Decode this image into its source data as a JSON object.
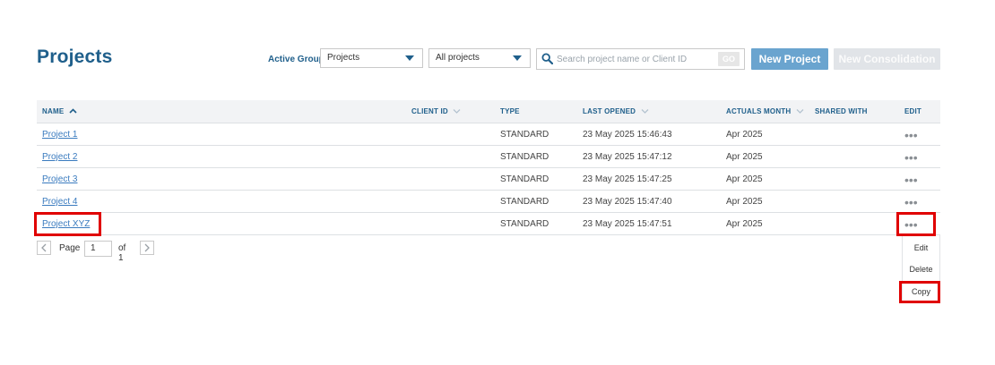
{
  "header": {
    "title": "Projects",
    "active_group_label": "Active Group",
    "group_select_value": "Projects",
    "filter_select_value": "All projects",
    "search_placeholder": "Search project name or Client ID",
    "search_value": "",
    "go_label": "GO",
    "new_project_label": "New Project",
    "new_consolidation_label": "New Consolidation"
  },
  "table": {
    "columns": {
      "name": "NAME",
      "client_id": "CLIENT ID",
      "type": "TYPE",
      "last_opened": "LAST OPENED",
      "actuals_month": "ACTUALS MONTH",
      "shared_with": "SHARED WITH",
      "edit": "EDIT"
    },
    "rows": [
      {
        "name": "Project 1",
        "client_id": "",
        "type": "STANDARD",
        "last_opened": "23 May 2025 15:46:43",
        "actuals_month": "Apr 2025",
        "shared_with": ""
      },
      {
        "name": "Project 2",
        "client_id": "",
        "type": "STANDARD",
        "last_opened": "23 May 2025 15:47:12",
        "actuals_month": "Apr 2025",
        "shared_with": ""
      },
      {
        "name": "Project 3",
        "client_id": "",
        "type": "STANDARD",
        "last_opened": "23 May 2025 15:47:25",
        "actuals_month": "Apr 2025",
        "shared_with": ""
      },
      {
        "name": "Project 4",
        "client_id": "",
        "type": "STANDARD",
        "last_opened": "23 May 2025 15:47:40",
        "actuals_month": "Apr 2025",
        "shared_with": ""
      },
      {
        "name": "Project XYZ",
        "client_id": "",
        "type": "STANDARD",
        "last_opened": "23 May 2025 15:47:51",
        "actuals_month": "Apr 2025",
        "shared_with": ""
      }
    ],
    "row_menu_glyph": "•••"
  },
  "pagination": {
    "page_label": "Page",
    "current_page": "1",
    "of_label": "of 1"
  },
  "context_menu": {
    "items": [
      "Edit",
      "Delete",
      "Copy"
    ]
  },
  "colors": {
    "accent": "#1f5f8b",
    "primary_button": "#6aa4cf",
    "disabled_button": "#e1e4e8",
    "link": "#3a7bbf",
    "highlight": "#e00000"
  }
}
